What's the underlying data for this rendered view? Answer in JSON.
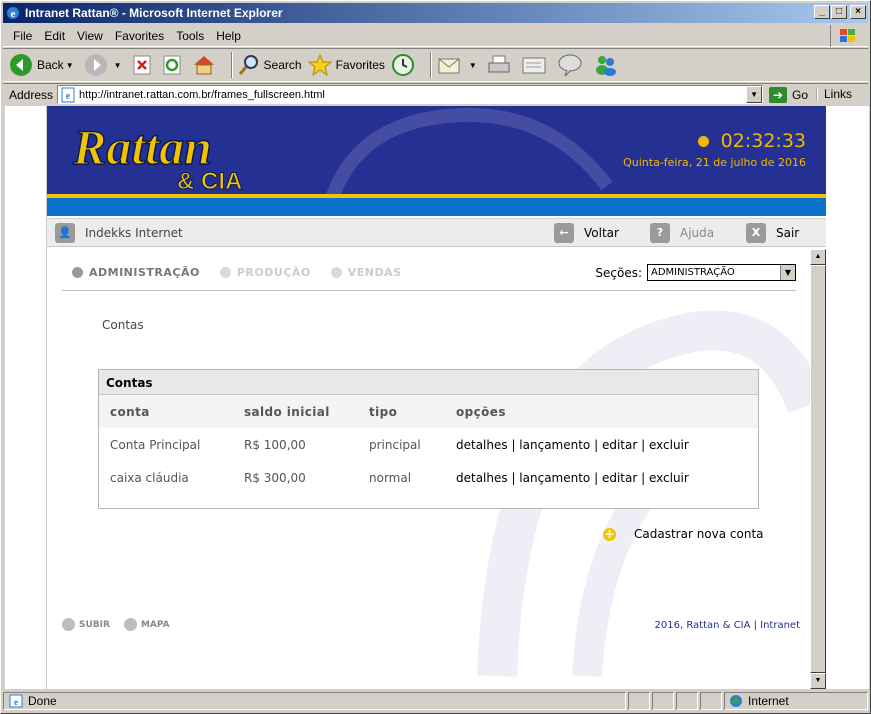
{
  "window": {
    "title": "Intranet Rattan® - Microsoft Internet Explorer"
  },
  "menu": [
    "File",
    "Edit",
    "View",
    "Favorites",
    "Tools",
    "Help"
  ],
  "toolbar": {
    "back": "Back",
    "search": "Search",
    "favorites": "Favorites"
  },
  "address": {
    "label": "Address",
    "url": "http://intranet.rattan.com.br/frames_fullscreen.html",
    "go": "Go",
    "links": "Links"
  },
  "header": {
    "logo_top": "Rattan",
    "logo_bottom": "& CIA",
    "time": "02:32:33",
    "date": "Quinta-feira, 21 de julho de 2016"
  },
  "nav": {
    "user": "Indekks Internet",
    "back": "Voltar",
    "help": "Ajuda",
    "exit": "Sair"
  },
  "sections": {
    "tabs": [
      "ADMINISTRAÇÃO",
      "PRODUÇÃO",
      "VENDAS"
    ],
    "label": "Seções:",
    "selected": "ADMINISTRAÇÃO"
  },
  "breadcrumb": "Contas",
  "table": {
    "title": "Contas",
    "headers": [
      "conta",
      "saldo inicial",
      "tipo",
      "opções"
    ],
    "rows": [
      {
        "conta": "Conta Principal",
        "saldo": "R$ 100,00",
        "tipo": "principal",
        "opcoes": "detalhes | lançamento | editar | excluir"
      },
      {
        "conta": "caixa cláudia",
        "saldo": "R$ 300,00",
        "tipo": "normal",
        "opcoes": "detalhes | lançamento | editar | excluir"
      }
    ]
  },
  "add_account": "Cadastrar nova conta",
  "footer": {
    "up": "SUBIR",
    "map": "MAPA",
    "copyright": "2016, Rattan & CIA | Intranet"
  },
  "status": {
    "text": "Done",
    "zone": "Internet"
  },
  "colors": {
    "banner": "#253093",
    "accent": "#f2c400",
    "stripe": "#0b72c9"
  }
}
